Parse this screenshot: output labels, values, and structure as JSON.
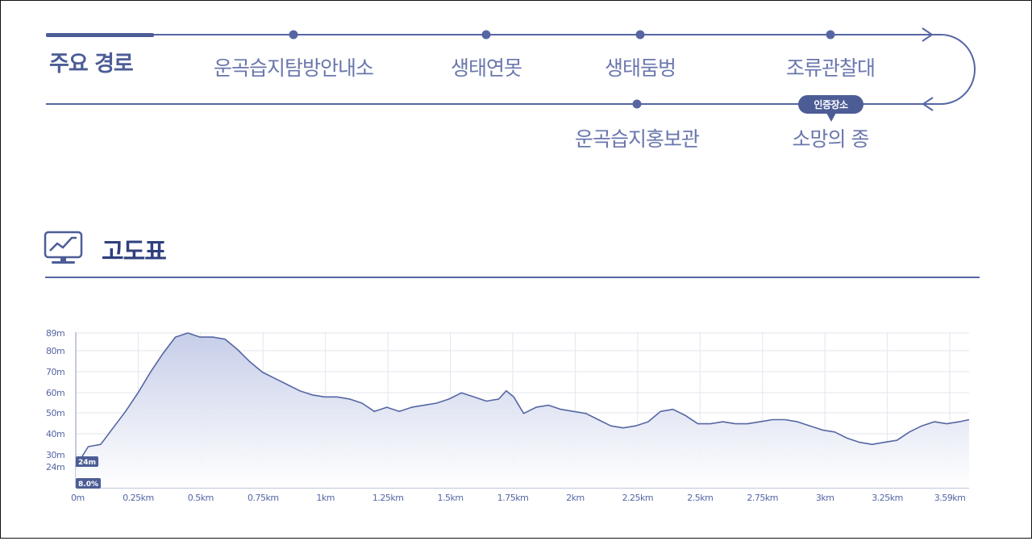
{
  "route": {
    "title": "주요 경로",
    "stops_top": [
      "운곡습지탐방안내소",
      "생태연못",
      "생태둠벙",
      "조류관찰대"
    ],
    "stops_bottom": [
      "운곡습지홍보관",
      "소망의 종"
    ],
    "certified_label": "인증장소"
  },
  "elevation_section": {
    "title": "고도표",
    "icon": "line-chart-monitor-icon"
  },
  "colors": {
    "primary": "#5566a3",
    "title": "#2f3f7d",
    "grid": "#d9dce6",
    "fill_top": "#c3cbe7",
    "fill_bottom": "#ffffff"
  },
  "chart_data": {
    "type": "area",
    "xlabel": "",
    "ylabel": "",
    "x_ticks": [
      "0m",
      "0.25km",
      "0.5km",
      "0.75km",
      "1km",
      "1.25km",
      "1.5km",
      "1.75km",
      "2km",
      "2.25km",
      "2.5km",
      "2.75km",
      "3km",
      "3.25km",
      "3.59km"
    ],
    "y_ticks": [
      "24m",
      "30m",
      "40m",
      "50m",
      "60m",
      "70m",
      "80m",
      "89m"
    ],
    "xlim": [
      0,
      3.59
    ],
    "ylim": [
      24,
      89
    ],
    "x_unit": "km",
    "y_unit": "m",
    "grid": true,
    "start_elevation_label": "24m",
    "slope_label": "8.0%",
    "series": [
      {
        "x": [
          0,
          0.05,
          0.1,
          0.15,
          0.2,
          0.25,
          0.3,
          0.35,
          0.4,
          0.45,
          0.5,
          0.55,
          0.6,
          0.65,
          0.7,
          0.75,
          0.8,
          0.85,
          0.9,
          0.95,
          1.0,
          1.05,
          1.1,
          1.15,
          1.2,
          1.25,
          1.3,
          1.35,
          1.4,
          1.45,
          1.5,
          1.55,
          1.6,
          1.65,
          1.7,
          1.73,
          1.76,
          1.8,
          1.85,
          1.9,
          1.95,
          2.0,
          2.05,
          2.1,
          2.15,
          2.2,
          2.25,
          2.3,
          2.35,
          2.4,
          2.45,
          2.5,
          2.55,
          2.6,
          2.65,
          2.7,
          2.75,
          2.8,
          2.85,
          2.9,
          2.95,
          3.0,
          3.05,
          3.1,
          3.15,
          3.2,
          3.25,
          3.3,
          3.35,
          3.4,
          3.45,
          3.5,
          3.55,
          3.59
        ],
        "y": [
          24,
          29,
          35,
          43,
          51,
          60,
          70,
          79,
          87,
          89,
          87,
          87,
          86,
          81,
          75,
          70,
          67,
          64,
          61,
          59,
          58,
          58,
          57,
          55,
          51,
          53,
          51,
          53,
          54,
          55,
          57,
          60,
          58,
          56,
          57,
          61,
          58,
          50,
          53,
          54,
          52,
          51,
          50,
          47,
          44,
          43,
          44,
          46,
          51,
          52,
          49,
          45,
          45,
          46,
          45,
          45,
          46,
          47,
          47,
          46,
          44,
          42,
          41,
          38,
          36,
          35,
          36,
          37,
          41,
          44,
          46,
          45,
          46,
          47
        ]
      }
    ]
  }
}
